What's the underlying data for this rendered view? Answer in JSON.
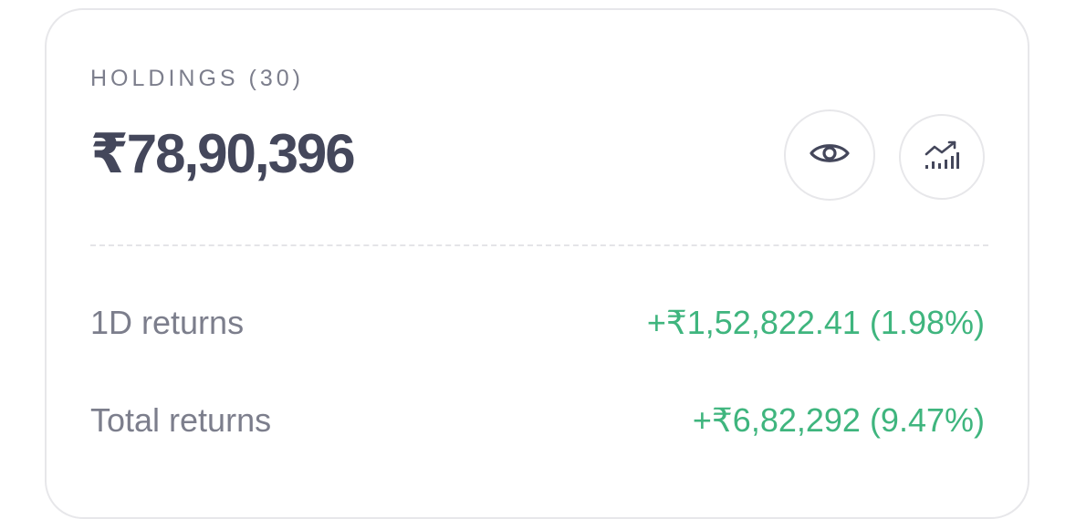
{
  "holdings": {
    "label": "HOLDINGS (30)",
    "total_value": "₹78,90,396"
  },
  "actions": {
    "eye_icon": "eye-icon",
    "chart_icon": "bar-chart-trend-icon"
  },
  "returns": [
    {
      "label": "1D returns",
      "value": "+₹1,52,822.41 (1.98%)"
    },
    {
      "label": "Total returns",
      "value": "+₹6,82,292 (9.47%)"
    }
  ],
  "colors": {
    "positive": "#3fb57e",
    "muted_text": "#7c7e8c",
    "primary_text": "#44475b",
    "border": "#e7e7ea"
  }
}
